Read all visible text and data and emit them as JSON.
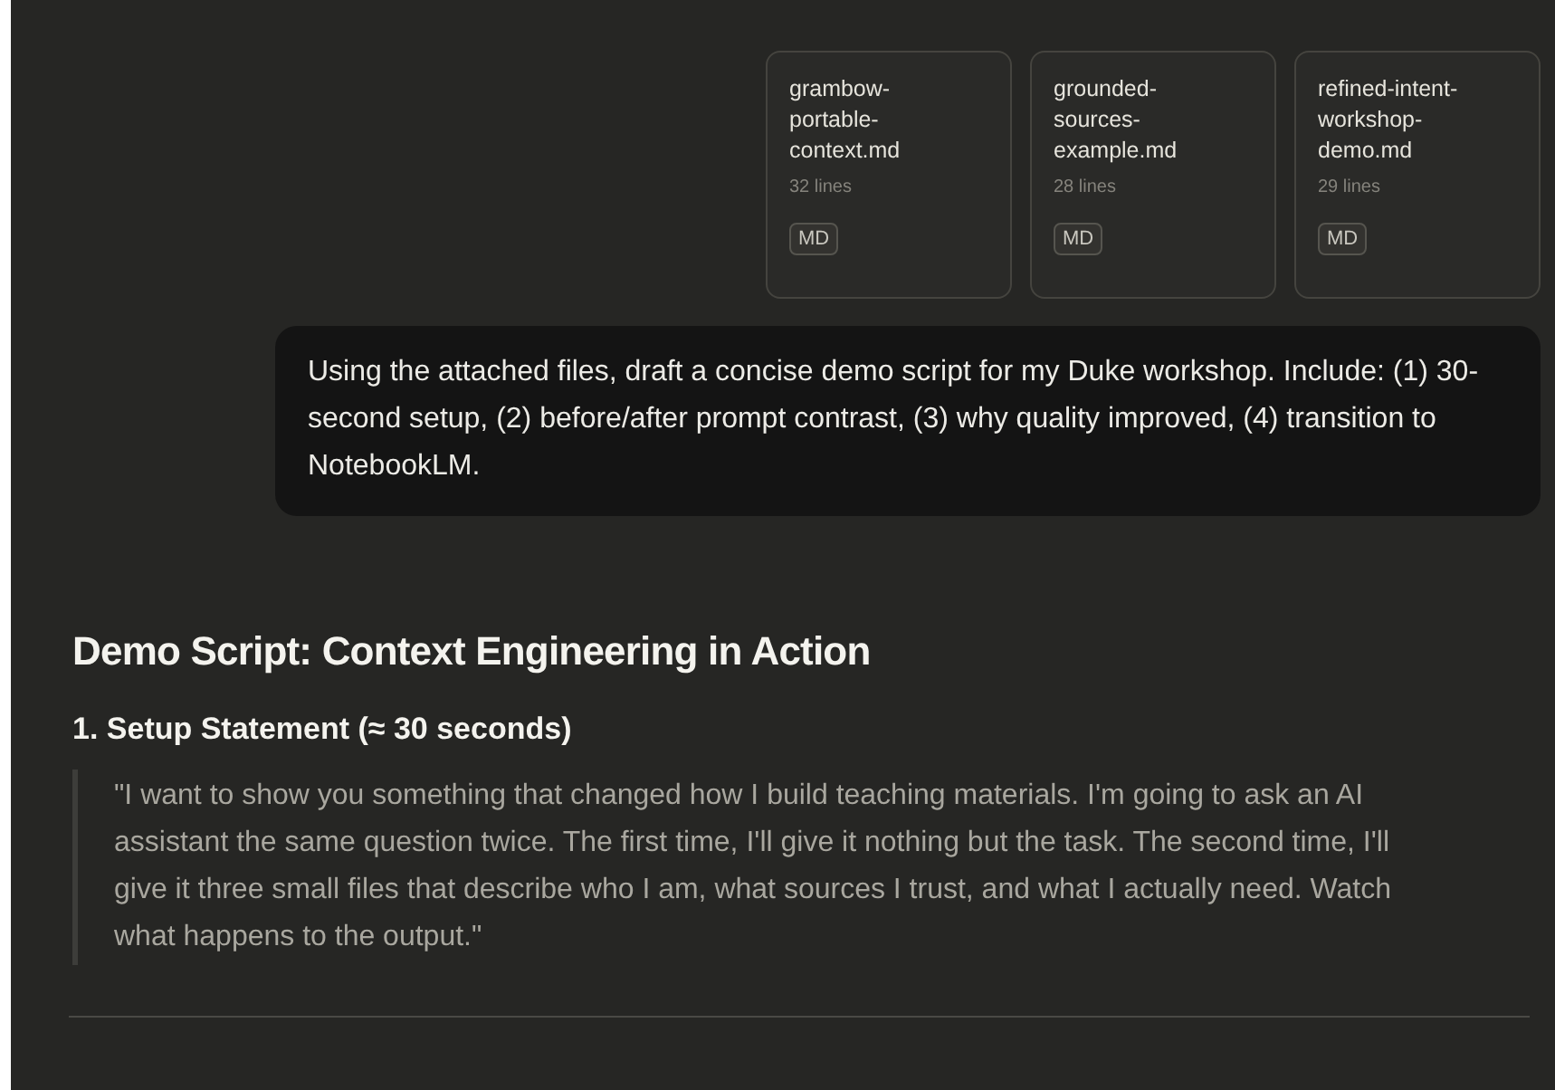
{
  "attachments": [
    {
      "name": "grambow-portable-context.md",
      "lines": "32 lines",
      "type": "MD"
    },
    {
      "name": "grounded-sources-example.md",
      "lines": "28 lines",
      "type": "MD"
    },
    {
      "name": "refined-intent-workshop-demo.md",
      "lines": "29 lines",
      "type": "MD"
    }
  ],
  "user_message": "Using the attached files, draft a concise demo script for my Duke workshop. Include: (1) 30-second setup, (2) before/after prompt contrast, (3) why quality improved, (4) transition to NotebookLM.",
  "response": {
    "title": "Demo Script: Context Engineering in Action",
    "sections": [
      {
        "heading": "1. Setup Statement (≈ 30 seconds)",
        "quote": "\"I want to show you something that changed how I build teaching materials. I'm going to ask an AI assistant the same question twice. The first time, I'll give it nothing but the task. The second time, I'll give it three small files that describe who I am, what sources I trust, and what I actually need. Watch what happens to the output.\""
      }
    ]
  }
}
